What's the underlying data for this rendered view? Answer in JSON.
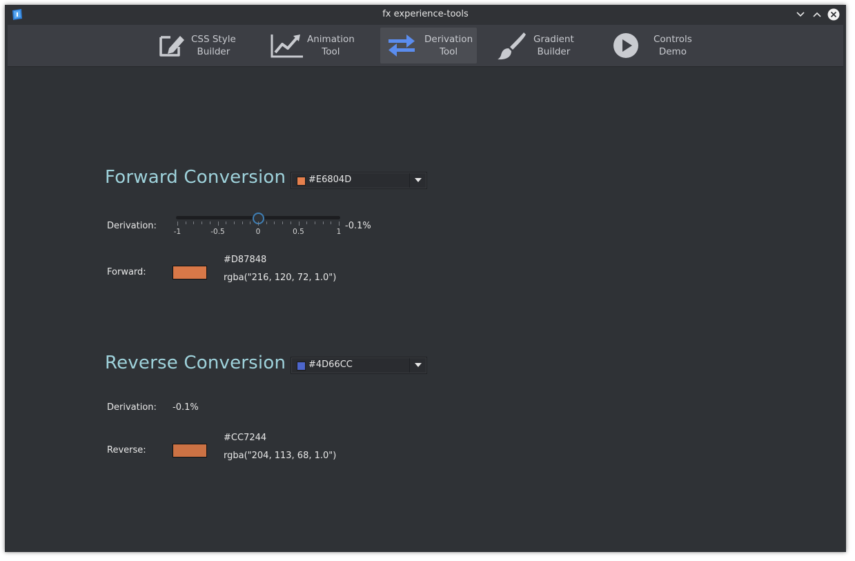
{
  "window": {
    "title": "fx experience-tools"
  },
  "toolbar": {
    "items": [
      {
        "label": "CSS Style\nBuilder",
        "icon": "pencil-edit-icon",
        "active": false
      },
      {
        "label": "Animation\nTool",
        "icon": "chart-line-icon",
        "active": false
      },
      {
        "label": "Derivation\nTool",
        "icon": "swap-arrows-icon",
        "active": true
      },
      {
        "label": "Gradient\nBuilder",
        "icon": "paint-brush-icon",
        "active": false
      },
      {
        "label": "Controls\nDemo",
        "icon": "play-circle-icon",
        "active": false
      }
    ]
  },
  "forward": {
    "title": "Forward Conversion",
    "color_value": "#E6804D",
    "derivation_label": "Derivation:",
    "slider": {
      "value": -0.001,
      "min": -1,
      "max": 1,
      "ticks": [
        "-1",
        "-0.5",
        "0",
        "0.5",
        "1"
      ]
    },
    "derivation_value": "-0.1%",
    "result_label": "Forward:",
    "result_hex": "#D87848",
    "result_rgba": "rgba(\"216, 120, 72, 1.0\")",
    "result_color": "#D87848"
  },
  "reverse": {
    "title": "Reverse Conversion",
    "color_value": "#4D66CC",
    "derivation_label": "Derivation:",
    "derivation_value": "-0.1%",
    "result_label": "Reverse:",
    "result_hex": "#CC7244",
    "result_rgba": "rgba(\"204, 113, 68, 1.0\")",
    "result_color": "#CC7244"
  },
  "colors": {
    "accent_title": "#9FD3DC",
    "toolbar_active_icon": "#5B8DEF",
    "toolbar_icon": "#C9CBD0"
  }
}
